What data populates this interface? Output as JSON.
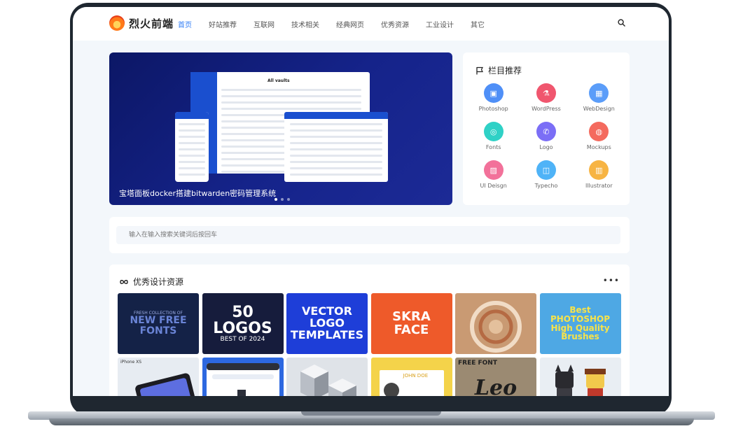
{
  "site": {
    "logo_text": "烈火前端"
  },
  "nav": {
    "items": [
      "首页",
      "好站推荐",
      "互联网",
      "技术相关",
      "经典网页",
      "优秀资源",
      "工业设计",
      "其它"
    ],
    "active_index": 0
  },
  "banner": {
    "caption": "宝塔面板docker搭建bitwarden密码管理系统",
    "mock_title": "All vaults",
    "slides": 3,
    "active_slide": 1
  },
  "category": {
    "title": "栏目推荐",
    "items": [
      {
        "label": "Photoshop",
        "icon": "photoshop-icon",
        "color": "#4f8ff7"
      },
      {
        "label": "WordPress",
        "icon": "flask-icon",
        "color": "#f0566e"
      },
      {
        "label": "WebDesign",
        "icon": "grid-icon",
        "color": "#5b9df9"
      },
      {
        "label": "Fonts",
        "icon": "fonts-icon",
        "color": "#2fd1c6"
      },
      {
        "label": "Logo",
        "icon": "chat-icon",
        "color": "#7b6ef6"
      },
      {
        "label": "Mockups",
        "icon": "globe-icon",
        "color": "#f46a5e"
      },
      {
        "label": "UI Deisgn",
        "icon": "image-icon",
        "color": "#f2719a"
      },
      {
        "label": "Typecho",
        "icon": "gamepad-icon",
        "color": "#4fb3f7"
      },
      {
        "label": "Illustrator",
        "icon": "book-icon",
        "color": "#f7b443"
      }
    ]
  },
  "search": {
    "placeholder": "输入在输入搜索关键词后按回车"
  },
  "resources": {
    "title": "优秀设计资源",
    "thumbs": [
      {
        "text": "NEW FREE FONTS",
        "sub": "FRESH COLLECTION OF"
      },
      {
        "text": "50 LOGOS",
        "sub": "BEST OF 2024"
      },
      {
        "text": "VECTOR LOGO TEMPLATES",
        "sub": ""
      },
      {
        "text": "SKRA FACE",
        "sub": ""
      },
      {
        "text": "",
        "sub": ""
      },
      {
        "text": "Best PHOTOSHOP High Quality Brushes",
        "sub": ""
      },
      {
        "text": "iPhone XS",
        "sub": ""
      },
      {
        "text": "",
        "sub": ""
      },
      {
        "text": "",
        "sub": ""
      },
      {
        "text": "JOHN DOE",
        "sub": ""
      },
      {
        "text": "Leo",
        "sub": "FREE FONT"
      },
      {
        "text": "",
        "sub": ""
      }
    ]
  }
}
